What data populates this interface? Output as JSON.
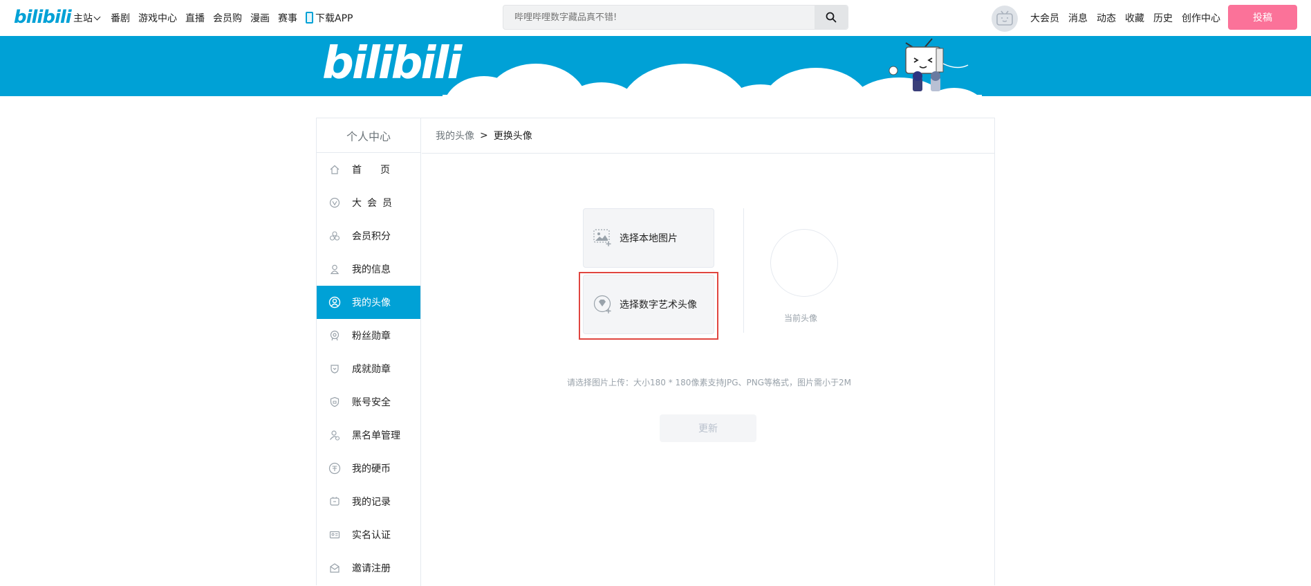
{
  "header": {
    "logo_text": "bilibili",
    "nav": [
      {
        "label": "主站",
        "has_dropdown": true
      },
      {
        "label": "番剧"
      },
      {
        "label": "游戏中心"
      },
      {
        "label": "直播"
      },
      {
        "label": "会员购"
      },
      {
        "label": "漫画"
      },
      {
        "label": "赛事"
      },
      {
        "label": "下载APP",
        "icon": "phone-icon"
      }
    ],
    "search": {
      "placeholder": "哔哩哔哩数字藏品真不错!",
      "value": ""
    },
    "right_nav": [
      "大会员",
      "消息",
      "动态",
      "收藏",
      "历史",
      "创作中心"
    ],
    "upload_label": "投稿"
  },
  "banner": {
    "logo_text": "bilibili"
  },
  "sidebar": {
    "title": "个人中心",
    "items": [
      {
        "label": "首页",
        "icon": "home-icon",
        "style": "wide"
      },
      {
        "label": "大会员",
        "icon": "vip-icon",
        "style": "spaced"
      },
      {
        "label": "会员积分",
        "icon": "points-icon"
      },
      {
        "label": "我的信息",
        "icon": "user-icon"
      },
      {
        "label": "我的头像",
        "icon": "avatar-icon",
        "active": true
      },
      {
        "label": "粉丝勋章",
        "icon": "fan-medal-icon"
      },
      {
        "label": "成就勋章",
        "icon": "achievement-icon"
      },
      {
        "label": "账号安全",
        "icon": "shield-icon"
      },
      {
        "label": "黑名单管理",
        "icon": "blacklist-icon"
      },
      {
        "label": "我的硬币",
        "icon": "coin-icon"
      },
      {
        "label": "我的记录",
        "icon": "record-icon"
      },
      {
        "label": "实名认证",
        "icon": "id-card-icon"
      },
      {
        "label": "邀请注册",
        "icon": "invite-icon"
      }
    ]
  },
  "breadcrumb": {
    "parent": "我的头像",
    "separator": ">",
    "current": "更换头像"
  },
  "options": {
    "local": "选择本地图片",
    "digital": "选择数字艺术头像"
  },
  "current_avatar_label": "当前头像",
  "hint": "请选择图片上传：大小180 * 180像素支持JPG、PNG等格式，图片需小于2M",
  "update_button": "更新",
  "colors": {
    "brand_blue": "#00a1d6",
    "upload_pink": "#fb7299",
    "highlight_red": "#e0453f"
  }
}
